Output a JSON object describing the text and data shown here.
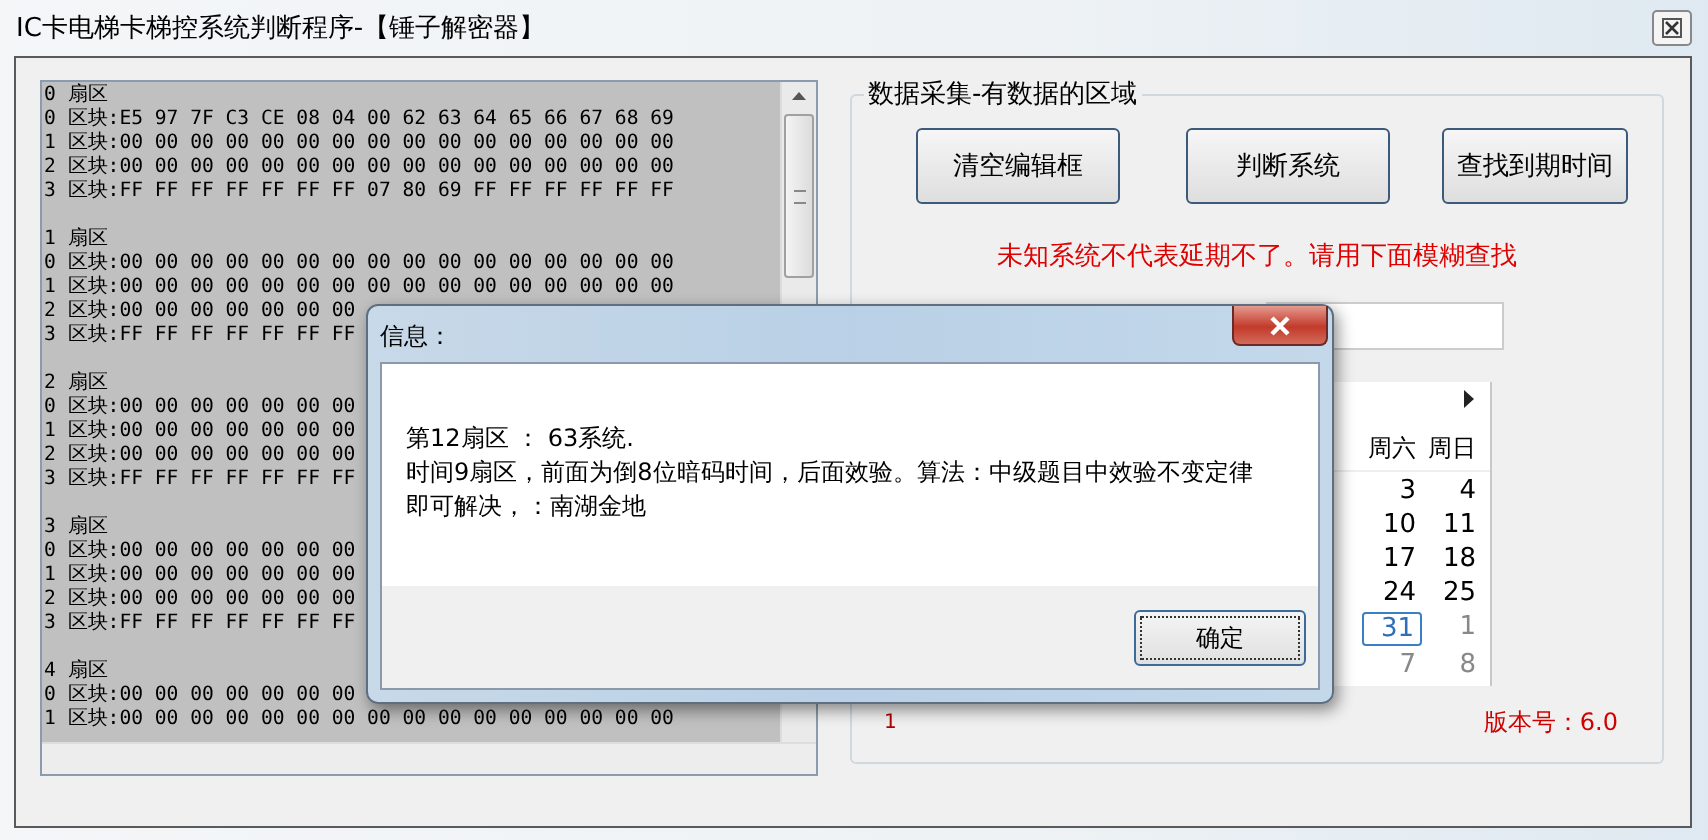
{
  "window": {
    "title": "IC卡电梯卡梯控系统判断程序-【锤子解密器】"
  },
  "dump": {
    "sectors": [
      {
        "header": "0 扇区",
        "blocks": [
          "0 区块:E5 97 7F C3 CE 08 04 00 62 63 64 65 66 67 68 69",
          "1 区块:00 00 00 00 00 00 00 00 00 00 00 00 00 00 00 00",
          "2 区块:00 00 00 00 00 00 00 00 00 00 00 00 00 00 00 00",
          "3 区块:FF FF FF FF FF FF FF 07 80 69 FF FF FF FF FF FF"
        ]
      },
      {
        "header": "1 扇区",
        "blocks": [
          "0 区块:00 00 00 00 00 00 00 00 00 00 00 00 00 00 00 00",
          "1 区块:00 00 00 00 00 00 00 00 00 00 00 00 00 00 00 00",
          "2 区块:00 00 00 00 00 00 00",
          "3 区块:FF FF FF FF FF FF FF"
        ]
      },
      {
        "header": "2 扇区",
        "blocks": [
          "0 区块:00 00 00 00 00 00 00",
          "1 区块:00 00 00 00 00 00 00",
          "2 区块:00 00 00 00 00 00 00",
          "3 区块:FF FF FF FF FF FF FF"
        ]
      },
      {
        "header": "3 扇区",
        "blocks": [
          "0 区块:00 00 00 00 00 00 00",
          "1 区块:00 00 00 00 00 00 00",
          "2 区块:00 00 00 00 00 00 00",
          "3 区块:FF FF FF FF FF FF FF"
        ]
      },
      {
        "header": "4 扇区",
        "blocks": [
          "0 区块:00 00 00 00 00 00 00",
          "1 区块:00 00 00 00 00 00 00 00 00 00 00 00 00 00 00 00"
        ]
      }
    ]
  },
  "group": {
    "title": "数据采集-有数据的区域",
    "buttons": [
      "清空编辑框",
      "判断系统",
      "查找到期时间"
    ],
    "warning": "未知系统不代表延期不了。请用下面模糊查找",
    "counter": "1",
    "version": "版本号：6.0"
  },
  "calendar": {
    "headers": [
      "周六",
      "周日"
    ],
    "weeks": [
      [
        {
          "day": "3",
          "selected": false,
          "other_month": false
        },
        {
          "day": "4",
          "selected": false,
          "other_month": false
        }
      ],
      [
        {
          "day": "10",
          "selected": false,
          "other_month": false
        },
        {
          "day": "11",
          "selected": false,
          "other_month": false
        }
      ],
      [
        {
          "day": "17",
          "selected": false,
          "other_month": false
        },
        {
          "day": "18",
          "selected": false,
          "other_month": false
        }
      ],
      [
        {
          "day": "24",
          "selected": false,
          "other_month": false
        },
        {
          "day": "25",
          "selected": false,
          "other_month": false
        }
      ],
      [
        {
          "day": "31",
          "selected": true,
          "other_month": false
        },
        {
          "day": "1",
          "selected": false,
          "other_month": true
        }
      ],
      [
        {
          "day": "7",
          "selected": false,
          "other_month": true
        },
        {
          "day": "8",
          "selected": false,
          "other_month": true
        }
      ]
    ]
  },
  "dialog": {
    "title": "信息：",
    "lines": [
      "第12扇区  ：  63系统.",
      "时间9扇区，前面为倒8位暗码时间，后面效验。算法：中级题目中效验不变定律",
      "即可解决，：南湖金地"
    ],
    "button": "确定"
  }
}
